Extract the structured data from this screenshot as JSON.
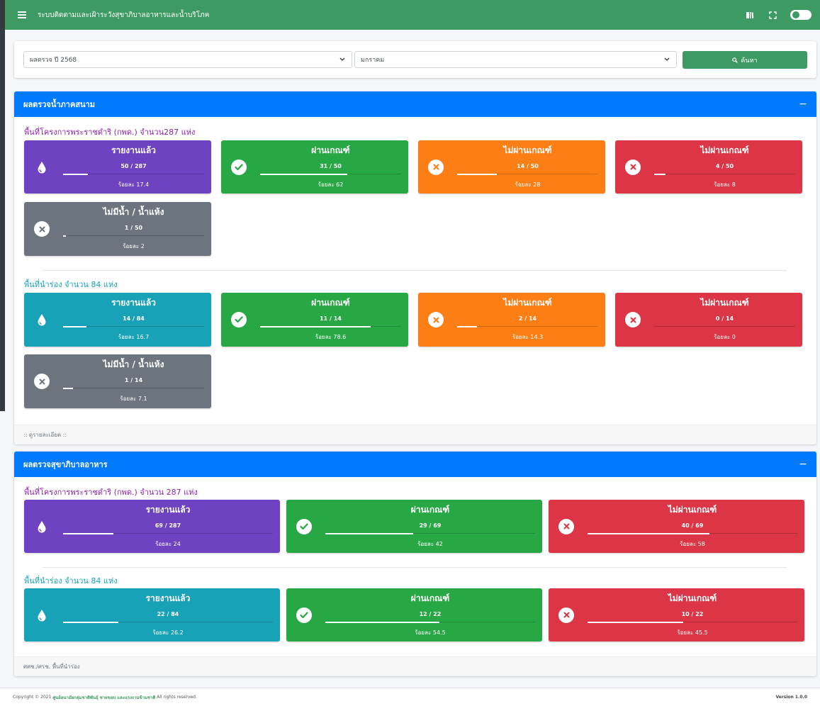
{
  "navbar": {
    "title": "ระบบติดตามและเฝ้าระวังสุขาภิบาลอาหารและน้ำบริโภค",
    "icons": [
      "menu-icon",
      "book-icon",
      "fullscreen-icon",
      "theme-toggle"
    ]
  },
  "filters": {
    "year_select": "ผลตรวจ ปี 2568",
    "month_select": "มกราคม",
    "search_label": "ค้นหา"
  },
  "water_card": {
    "title": "ผลตรวจน้ำภาคสนาม",
    "collapse": "−",
    "footer": ":: ดูรายละเอียด ::",
    "groups": [
      {
        "title": "พื้นที่โครงการพระราชดำริ (กพด.) จำนวน287 แห่ง",
        "stats": [
          {
            "label": "รายงานแล้ว",
            "count": "50 / 287",
            "pct": "ร้อยละ 17.4",
            "value": 17.4,
            "color": "purple",
            "icon": "water-drop-icon"
          },
          {
            "label": "ผ่านเกณฑ์",
            "count": "31 / 50",
            "pct": "ร้อยละ 62",
            "value": 62,
            "color": "green",
            "icon": "check-icon"
          },
          {
            "label": "ไม่ผ่านเกณฑ์",
            "count": "14 / 50",
            "pct": "ร้อยละ 28",
            "value": 28,
            "color": "orange",
            "icon": "x-icon"
          },
          {
            "label": "ไม่ผ่านเกณฑ์",
            "count": "4 / 50",
            "pct": "ร้อยละ 8",
            "value": 8,
            "color": "red",
            "icon": "x-icon"
          },
          {
            "label": "ไม่มีน้ำ / น้ำแห้ง",
            "count": "1 / 50",
            "pct": "ร้อยละ 2",
            "value": 2,
            "color": "gray",
            "icon": "x-icon"
          }
        ]
      },
      {
        "title": "พื้นที่นำร่อง จำนวน 84 แห่ง",
        "stats": [
          {
            "label": "รายงานแล้ว",
            "count": "14 / 84",
            "pct": "ร้อยละ 16.7",
            "value": 16.7,
            "color": "teal",
            "icon": "water-drop-icon"
          },
          {
            "label": "ผ่านเกณฑ์",
            "count": "11 / 14",
            "pct": "ร้อยละ 78.6",
            "value": 78.6,
            "color": "green",
            "icon": "check-icon"
          },
          {
            "label": "ไม่ผ่านเกณฑ์",
            "count": "2 / 14",
            "pct": "ร้อยละ 14.3",
            "value": 14.3,
            "color": "orange",
            "icon": "x-icon"
          },
          {
            "label": "ไม่ผ่านเกณฑ์",
            "count": "0 / 14",
            "pct": "ร้อยละ 0",
            "value": 0,
            "color": "red",
            "icon": "x-icon"
          },
          {
            "label": "ไม่มีน้ำ / น้ำแห้ง",
            "count": "1 / 14",
            "pct": "ร้อยละ 7.1",
            "value": 7.1,
            "color": "gray",
            "icon": "x-icon"
          }
        ]
      }
    ]
  },
  "food_card": {
    "title": "ผลตรวจสุขาภิบาลอาหาร",
    "collapse": "−",
    "footer": "ศศช./ศรช. พื้นที่นำร่อง",
    "groups": [
      {
        "title": "พื้นที่โครงการพระราชดำริ (กพด.) จำนวน 287 แห่ง",
        "stats": [
          {
            "label": "รายงานแล้ว",
            "count": "69 / 287",
            "pct": "ร้อยละ 24",
            "value": 24,
            "color": "purple",
            "icon": "water-drop-icon"
          },
          {
            "label": "ผ่านเกณฑ์",
            "count": "29 / 69",
            "pct": "ร้อยละ 42",
            "value": 42,
            "color": "green",
            "icon": "check-icon"
          },
          {
            "label": "ไม่ผ่านเกณฑ์",
            "count": "40 / 69",
            "pct": "ร้อยละ 58",
            "value": 58,
            "color": "red",
            "icon": "x-icon"
          }
        ]
      },
      {
        "title": "พื้นที่นำร่อง จำนวน 84 แห่ง",
        "stats": [
          {
            "label": "รายงานแล้ว",
            "count": "22 / 84",
            "pct": "ร้อยละ 26.2",
            "value": 26.2,
            "color": "teal",
            "icon": "water-drop-icon"
          },
          {
            "label": "ผ่านเกณฑ์",
            "count": "12 / 22",
            "pct": "ร้อยละ 54.5",
            "value": 54.5,
            "color": "green",
            "icon": "check-icon"
          },
          {
            "label": "ไม่ผ่านเกณฑ์",
            "count": "10 / 22",
            "pct": "ร้อยละ 45.5",
            "value": 45.5,
            "color": "red",
            "icon": "x-icon"
          }
        ]
      }
    ]
  },
  "footer": {
    "copyright": "Copyright © 2021",
    "org": "ศูนย์อนามัยกลุ่มชาติพันธุ์ ชายขอบ และแรงงานข้ามชาติ",
    "rights": "All rights reserved.",
    "version": "Version 1.0.0"
  },
  "colors": {
    "navbar": "#3d9a63",
    "header_blue": "#007bff",
    "purple": "#6f42c1",
    "green": "#28a745",
    "orange": "#fd7e14",
    "red": "#dc3545",
    "gray": "#6c757d",
    "teal": "#17a2b8"
  }
}
